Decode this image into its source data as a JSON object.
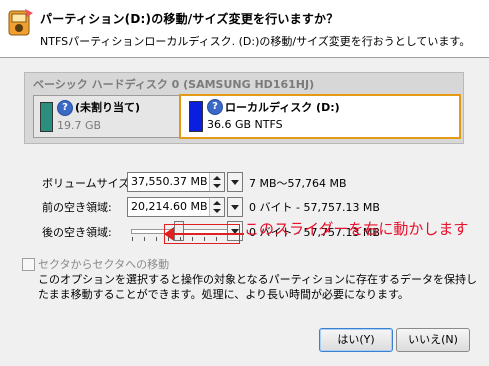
{
  "header": {
    "title": "パーティション(D:)の移動/サイズ変更を行いますか？",
    "subtitle": "NTFSパーティションローカルディスク. (D:)の移動/サイズ変更を行おうとしています。"
  },
  "disk": {
    "title": "ベーシック ハードディスク 0 (SAMSUNG HD161HJ)",
    "partitions": [
      {
        "name": "(未割り当て)",
        "size": "19.7 GB",
        "color": "#2a8e7e"
      },
      {
        "name": "ローカルディスク (D:)",
        "size": "36.6 GB NTFS",
        "color": "#0a1ee0"
      }
    ]
  },
  "fields": {
    "volume_size": {
      "label": "ボリュームサイズ:",
      "value": "37,550.37 MB",
      "range": "7 MB～57,764 MB"
    },
    "free_before": {
      "label": "前の空き領域:",
      "value": "20,214.60 MB",
      "range": "0 バイト - 57,757.13 MB"
    },
    "free_after": {
      "label": "後の空き領域:",
      "range": "0 バイト - 57,757.13 MB"
    }
  },
  "annotation": {
    "text": "このスライダーを右に動かします",
    "color": "#e8102a"
  },
  "sector": {
    "checkbox_label": "セクタからセクタへの移動",
    "description": "このオプションを選択すると操作の対象となるパーティションに存在するデータを保持したまま移動することができます。処理に、より長い時間が必要になります。"
  },
  "buttons": {
    "yes": "はい(Y)",
    "no": "いいえ(N)"
  }
}
